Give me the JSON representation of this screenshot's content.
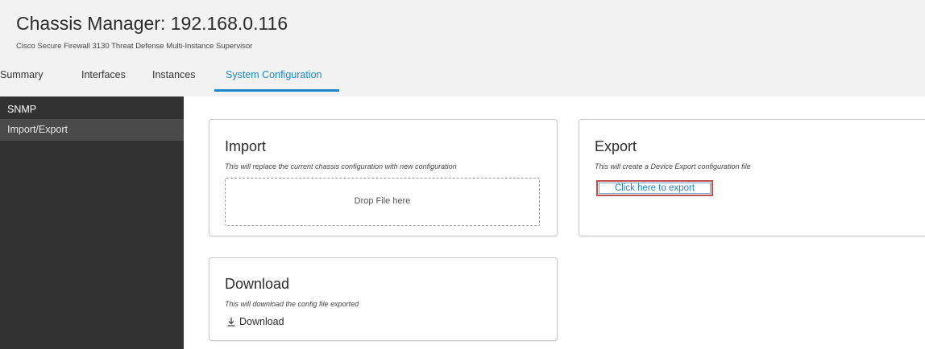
{
  "header": {
    "title": "Chassis Manager: 192.168.0.116",
    "subtitle": "Cisco Secure Firewall 3130 Threat Defense Multi-Instance Supervisor"
  },
  "tabs": [
    {
      "label": "Summary",
      "active": false
    },
    {
      "label": "Interfaces",
      "active": false
    },
    {
      "label": "Instances",
      "active": false
    },
    {
      "label": "System Configuration",
      "active": true
    }
  ],
  "sidebar": {
    "items": [
      {
        "label": "SNMP",
        "selected": false
      },
      {
        "label": "Import/Export",
        "selected": true
      }
    ]
  },
  "import_card": {
    "title": "Import",
    "description": "This will replace the current chassis configuration with new configuration",
    "drop_zone": "Drop File here"
  },
  "export_card": {
    "title": "Export",
    "description": "This will create a Device Export configuration file",
    "link": "Click here to export"
  },
  "download_card": {
    "title": "Download",
    "description": "This will download the config file exported",
    "button": "Download",
    "icon": "download-icon"
  },
  "colors": {
    "accent": "#1d86c8",
    "sidebar_bg": "#323232",
    "sidebar_selected": "#4a4a4a",
    "header_bg": "#f2f2f3",
    "highlight_box": "#c0504d"
  }
}
